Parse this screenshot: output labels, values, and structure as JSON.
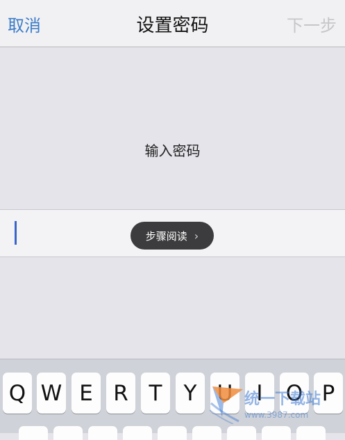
{
  "navbar": {
    "cancel_label": "取消",
    "title": "设置密码",
    "next_label": "下一步"
  },
  "content": {
    "prompt": "输入密码"
  },
  "tooltip": {
    "label": "步骤阅读",
    "chevron": "›"
  },
  "keyboard": {
    "row1": [
      "Q",
      "W",
      "E",
      "R",
      "T",
      "Y",
      "U",
      "I",
      "O",
      "P"
    ]
  },
  "watermark": {
    "text": "统一下载站",
    "url": "www.3987.com"
  },
  "colors": {
    "accent": "#3b7cc8",
    "disabled": "#c6c6ca",
    "cursor": "#3a64c9"
  }
}
